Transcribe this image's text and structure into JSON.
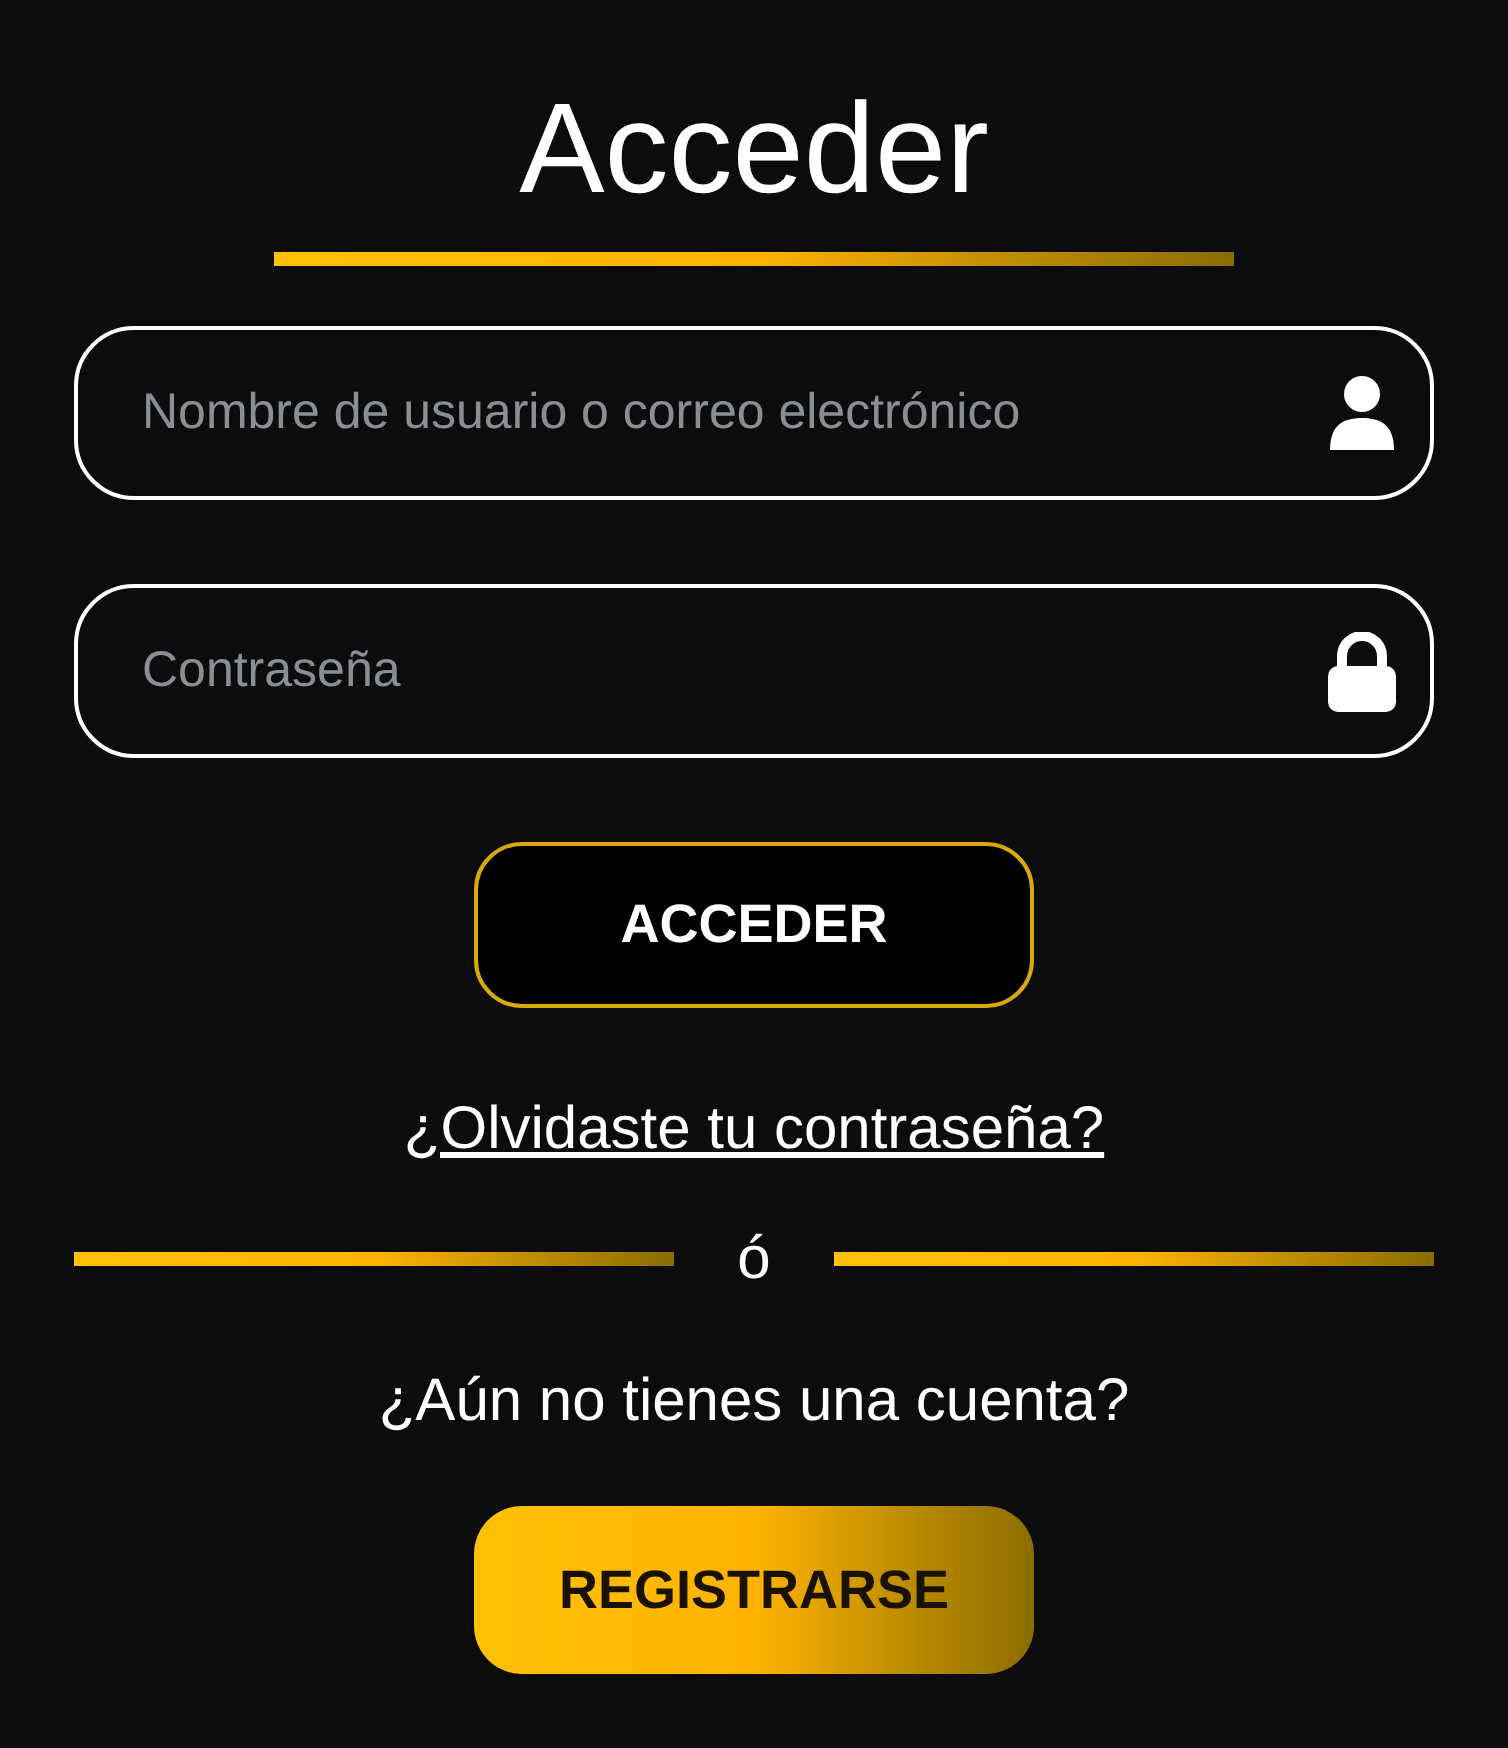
{
  "title": "Acceder",
  "fields": [
    {
      "placeholder": "Nombre de usuario o correo electrónico",
      "kind": "user"
    },
    {
      "placeholder": "Contraseña",
      "kind": "lock"
    }
  ],
  "submit_button": "ACCEDER",
  "forgot_link": "¿Olvidaste tu contraseña?",
  "separator": "ó",
  "signup_prompt": "¿Aún no tienes una cuenta?",
  "signup_button": "REGISTRARSE"
}
